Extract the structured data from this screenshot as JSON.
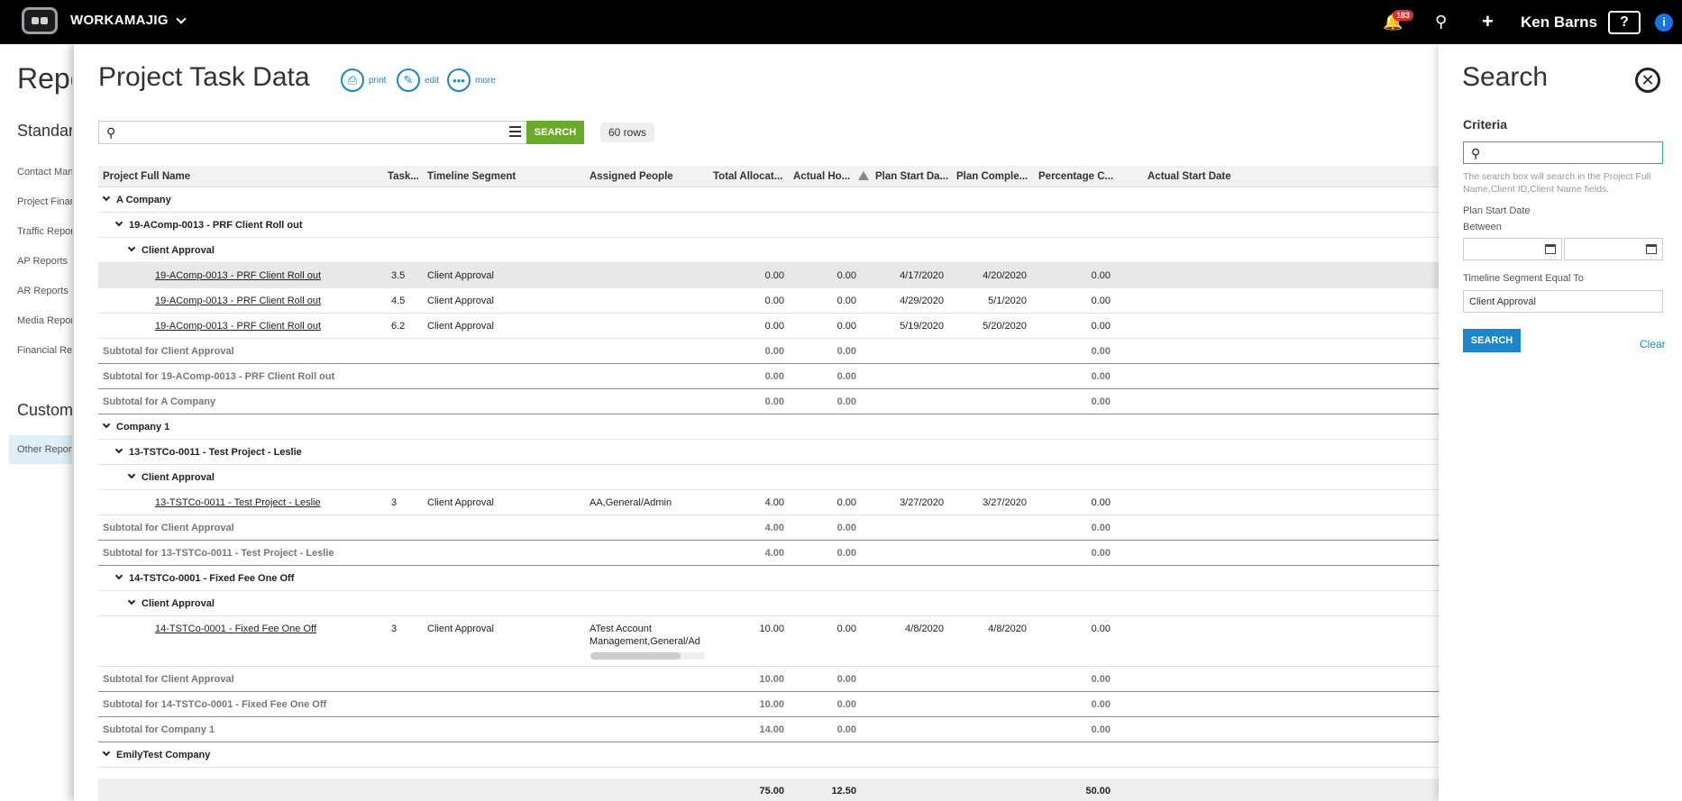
{
  "topbar": {
    "brand": "WORKAMAJIG",
    "notification_count": "183",
    "user_name": "Ken Barns",
    "help_label": "?",
    "info_label": "i"
  },
  "left": {
    "title": "Repo",
    "standard_heading": "Standar",
    "items": [
      "Contact Man",
      "Project Finan",
      "Traffic Repor",
      "AP Reports",
      "AR Reports",
      "Media Repor",
      "Financial Rep"
    ],
    "custom_heading": "Custom",
    "active_item": "Other Repor"
  },
  "main": {
    "title": "Project Task Data",
    "actions": [
      "print",
      "edit",
      "more"
    ],
    "search_button": "SEARCH",
    "rows_count": "60 rows",
    "columns": [
      "Project Full Name",
      "Task...",
      "Timeline Segment",
      "Assigned People",
      "Total Allocat...",
      "Actual Ho...",
      "Plan Start Da...",
      "Plan Comple...",
      "Percentage C...",
      "Actual Start Date"
    ],
    "rows": [
      {
        "kind": "group",
        "level": 0,
        "label": "A Company"
      },
      {
        "kind": "group",
        "level": 1,
        "label": "19-AComp-0013 - PRF Client Roll out"
      },
      {
        "kind": "group",
        "level": 2,
        "label": "Client Approval"
      },
      {
        "kind": "data",
        "hl": true,
        "name": "19-AComp-0013 - PRF Client Roll out",
        "task": "3.5",
        "segment": "Client Approval",
        "people": "",
        "alloc": "0.00",
        "actual": "0.00",
        "start": "4/17/2020",
        "complete": "4/20/2020",
        "pct": "0.00"
      },
      {
        "kind": "data",
        "name": "19-AComp-0013 - PRF Client Roll out",
        "task": "4.5",
        "segment": "Client Approval",
        "people": "",
        "alloc": "0.00",
        "actual": "0.00",
        "start": "4/29/2020",
        "complete": "5/1/2020",
        "pct": "0.00"
      },
      {
        "kind": "data",
        "name": "19-AComp-0013 - PRF Client Roll out",
        "task": "6.2",
        "segment": "Client Approval",
        "people": "",
        "alloc": "0.00",
        "actual": "0.00",
        "start": "5/19/2020",
        "complete": "5/20/2020",
        "pct": "0.00"
      },
      {
        "kind": "sub",
        "label": "Subtotal for Client Approval",
        "alloc": "0.00",
        "actual": "0.00",
        "pct": "0.00"
      },
      {
        "kind": "sub",
        "label": "Subtotal for 19-AComp-0013 - PRF Client Roll out",
        "alloc": "0.00",
        "actual": "0.00",
        "pct": "0.00"
      },
      {
        "kind": "sub",
        "label": "Subtotal for A Company",
        "alloc": "0.00",
        "actual": "0.00",
        "pct": "0.00"
      },
      {
        "kind": "group",
        "level": 0,
        "label": "Company 1"
      },
      {
        "kind": "group",
        "level": 1,
        "label": "13-TSTCo-0011 - Test Project - Leslie"
      },
      {
        "kind": "group",
        "level": 2,
        "label": "Client Approval"
      },
      {
        "kind": "data",
        "name": "13-TSTCo-0011 - Test Project - Leslie",
        "task": "3",
        "segment": "Client Approval",
        "people": "AA,General/Admin",
        "alloc": "4.00",
        "actual": "0.00",
        "start": "3/27/2020",
        "complete": "3/27/2020",
        "pct": "0.00"
      },
      {
        "kind": "sub",
        "label": "Subtotal for Client Approval",
        "alloc": "4.00",
        "actual": "0.00",
        "pct": "0.00"
      },
      {
        "kind": "sub",
        "label": "Subtotal for 13-TSTCo-0011 - Test Project - Leslie",
        "alloc": "4.00",
        "actual": "0.00",
        "pct": "0.00"
      },
      {
        "kind": "group",
        "level": 1,
        "label": "14-TSTCo-0001 - Fixed Fee One Off"
      },
      {
        "kind": "group",
        "level": 2,
        "label": "Client Approval"
      },
      {
        "kind": "data",
        "tall": true,
        "name": "14-TSTCo-0001 - Fixed Fee One Off",
        "task": "3",
        "segment": "Client Approval",
        "people": "ATest Account",
        "people2": "Management,General/Ad",
        "alloc": "10.00",
        "actual": "0.00",
        "start": "4/8/2020",
        "complete": "4/8/2020",
        "pct": "0.00"
      },
      {
        "kind": "sub",
        "label": "Subtotal for Client Approval",
        "alloc": "10.00",
        "actual": "0.00",
        "pct": "0.00"
      },
      {
        "kind": "sub",
        "label": "Subtotal for 14-TSTCo-0001 - Fixed Fee One Off",
        "alloc": "10.00",
        "actual": "0.00",
        "pct": "0.00"
      },
      {
        "kind": "sub",
        "label": "Subtotal for Company 1",
        "alloc": "14.00",
        "actual": "0.00",
        "pct": "0.00"
      },
      {
        "kind": "group",
        "level": 0,
        "label": "EmilyTest Company"
      }
    ],
    "totals": {
      "alloc": "75.00",
      "actual": "12.50",
      "pct": "50.00"
    }
  },
  "search_panel": {
    "title": "Search",
    "criteria_label": "Criteria",
    "help_text": "The search box will search in the Project Full Name,Client ID,Client Name fields.",
    "plan_start_label": "Plan Start Date",
    "between_label": "Between",
    "segment_label": "Timeline Segment Equal To",
    "segment_value": "Client Approval",
    "search_button": "SEARCH",
    "clear_label": "Clear"
  }
}
